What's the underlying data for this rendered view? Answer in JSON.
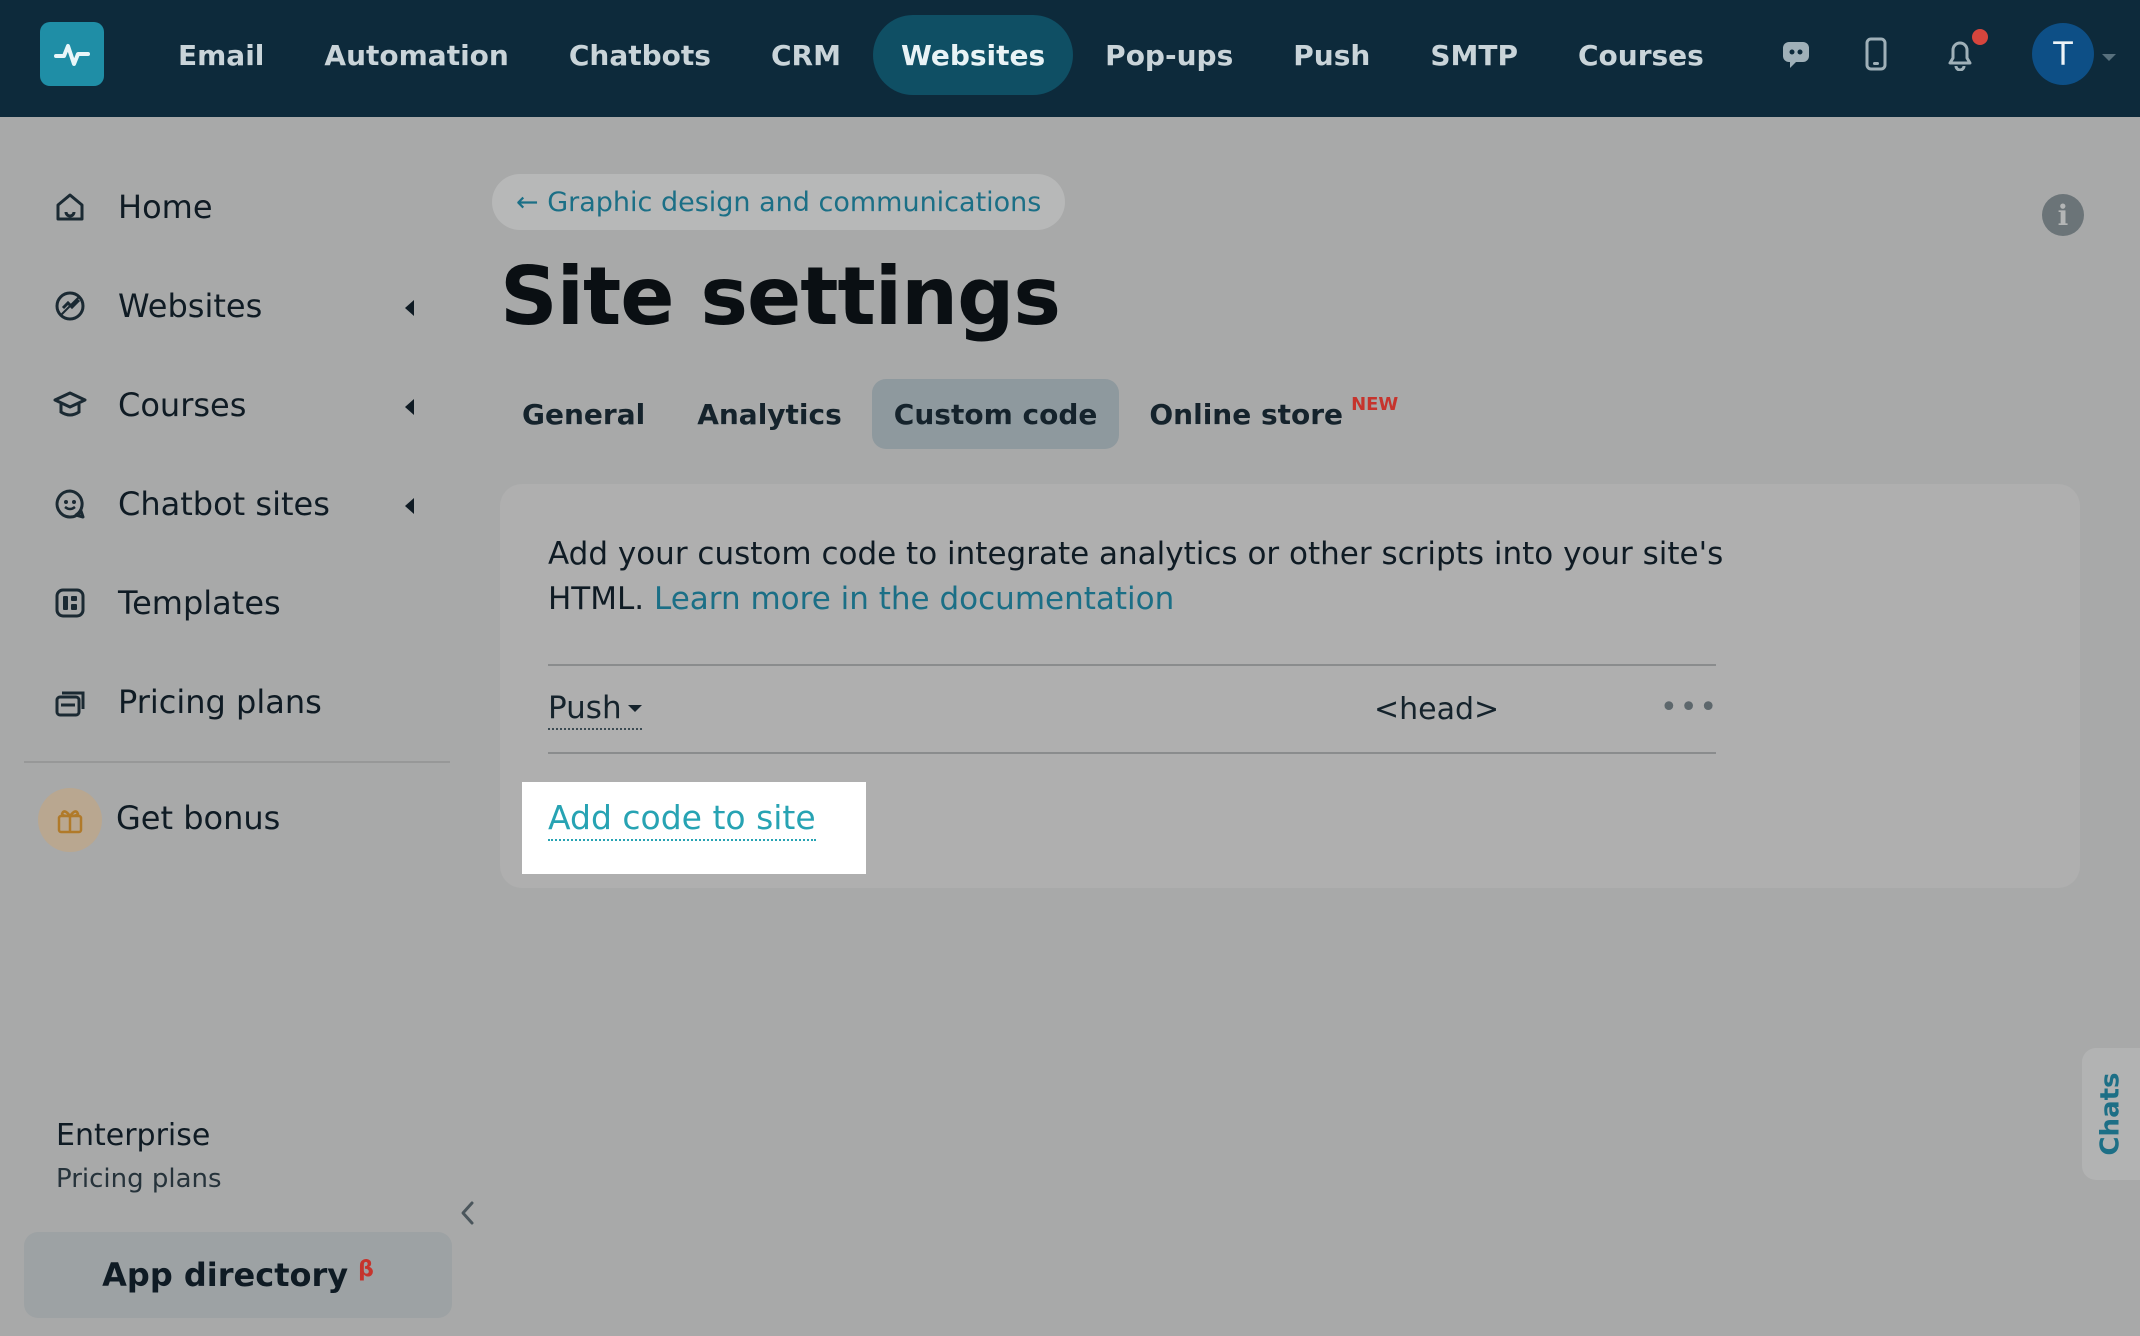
{
  "topnav": {
    "items": [
      {
        "label": "Email"
      },
      {
        "label": "Automation"
      },
      {
        "label": "Chatbots"
      },
      {
        "label": "CRM"
      },
      {
        "label": "Websites",
        "active": true
      },
      {
        "label": "Pop-ups"
      },
      {
        "label": "Push"
      },
      {
        "label": "SMTP"
      },
      {
        "label": "Courses"
      }
    ],
    "icons": [
      "chat-support-icon",
      "mobile-icon",
      "bell-icon"
    ],
    "avatar_initial": "T"
  },
  "sidebar": {
    "items": [
      {
        "label": "Home",
        "icon": "home-icon"
      },
      {
        "label": "Websites",
        "icon": "websites-icon",
        "expandable": true
      },
      {
        "label": "Courses",
        "icon": "graduation-cap-icon",
        "expandable": true
      },
      {
        "label": "Chatbot sites",
        "icon": "chatbot-icon",
        "expandable": true
      },
      {
        "label": "Templates",
        "icon": "templates-icon"
      },
      {
        "label": "Pricing plans",
        "icon": "pricing-icon"
      }
    ],
    "bonus": {
      "label": "Get bonus",
      "icon": "gift-icon"
    },
    "plan": {
      "name": "Enterprise",
      "link": "Pricing plans"
    },
    "app_directory": {
      "label": "App directory",
      "badge": "β"
    }
  },
  "main": {
    "back_link": "← Graphic design and communications",
    "title": "Site settings",
    "tabs": [
      {
        "label": "General"
      },
      {
        "label": "Analytics"
      },
      {
        "label": "Custom code",
        "active": true
      },
      {
        "label": "Online store",
        "badge": "NEW"
      }
    ],
    "card": {
      "description": "Add your custom code to integrate analytics or other scripts into your site's HTML.",
      "doc_link": "Learn more in the documentation",
      "code_rows": [
        {
          "name": "Push",
          "placement": "<head>",
          "menu": "•••"
        }
      ],
      "add_button": "Add code to site"
    }
  },
  "chats_tab": "Chats",
  "colors": {
    "topbar": "#0d2a3b",
    "accent": "#1b6f86",
    "active_link": "#27a3b3",
    "badge_red": "#c6342d"
  }
}
